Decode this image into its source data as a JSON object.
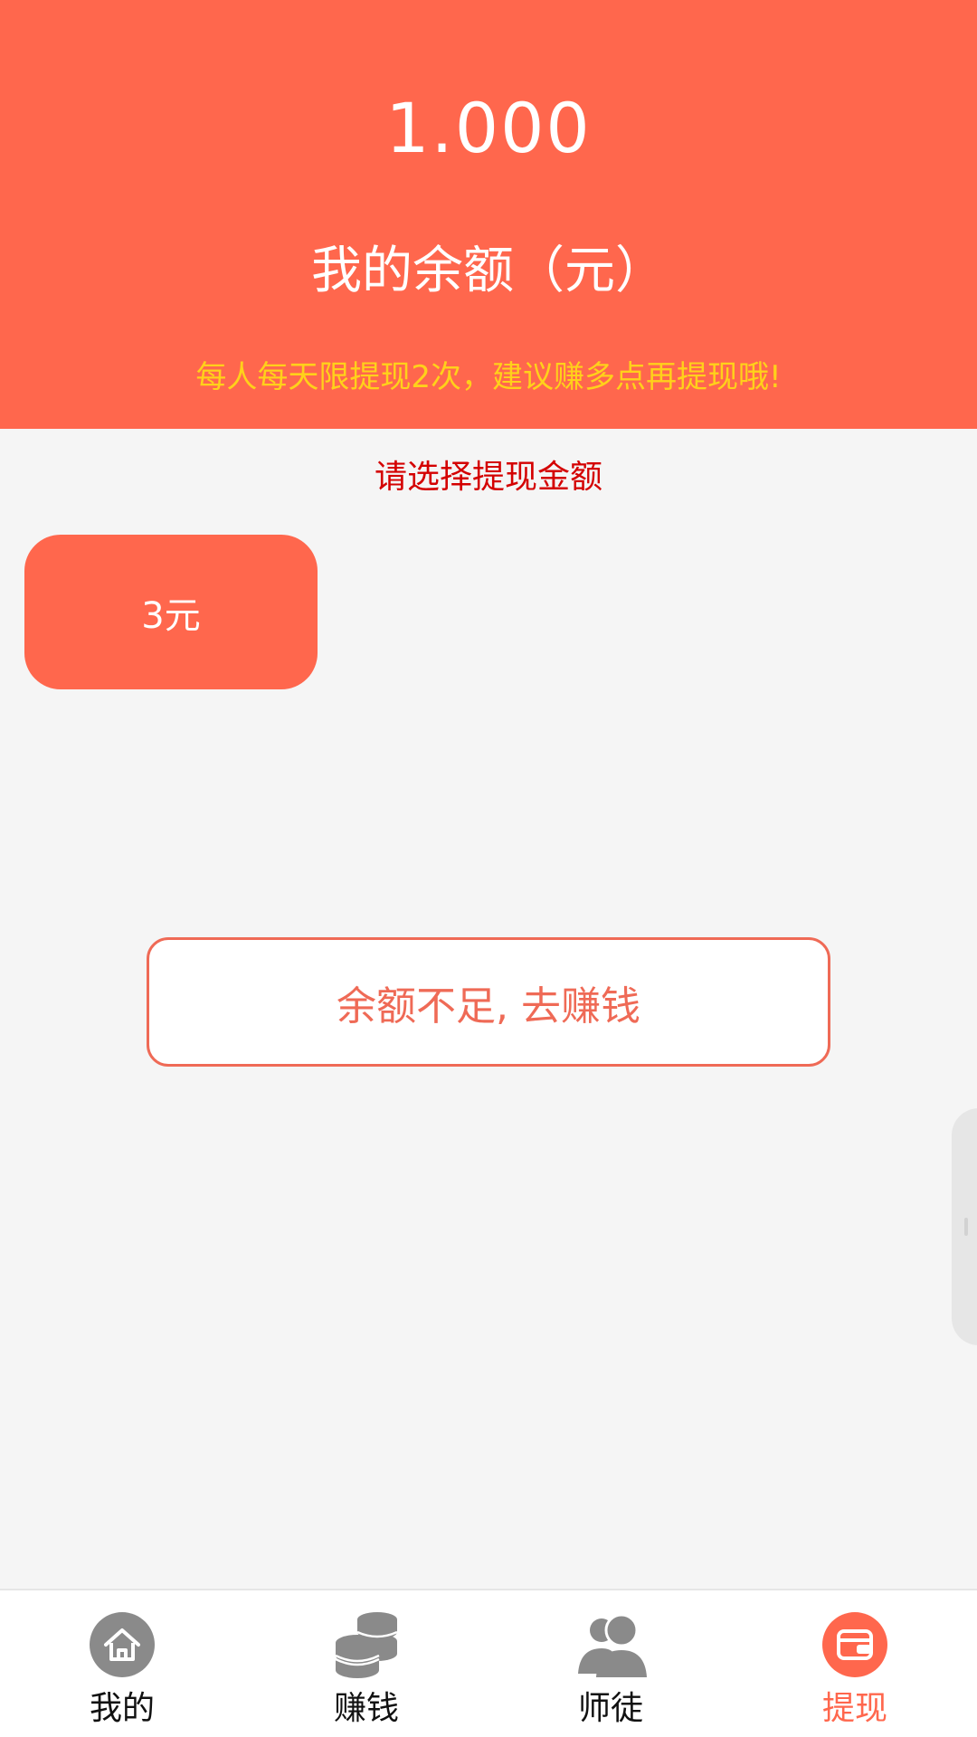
{
  "header": {
    "balance_amount": "1.000",
    "balance_label": "我的余额（元）",
    "limit_notice": "每人每天限提现2次，建议赚多点再提现哦!"
  },
  "withdraw": {
    "section_title": "请选择提现金额",
    "options": [
      "3元"
    ],
    "action_label": "余额不足, 去赚钱"
  },
  "tabbar": {
    "active": "withdraw",
    "tabs": [
      {
        "key": "mine",
        "label": "我的",
        "icon": "home-icon"
      },
      {
        "key": "earn",
        "label": "赚钱",
        "icon": "coins-icon"
      },
      {
        "key": "apprentice",
        "label": "师徒",
        "icon": "users-icon"
      },
      {
        "key": "withdraw",
        "label": "提现",
        "icon": "wallet-icon"
      }
    ]
  },
  "colors": {
    "brand": "#ff674d",
    "notice": "#ffd11a",
    "section_title": "#d40000",
    "icon_inactive": "#8a8a8a"
  }
}
